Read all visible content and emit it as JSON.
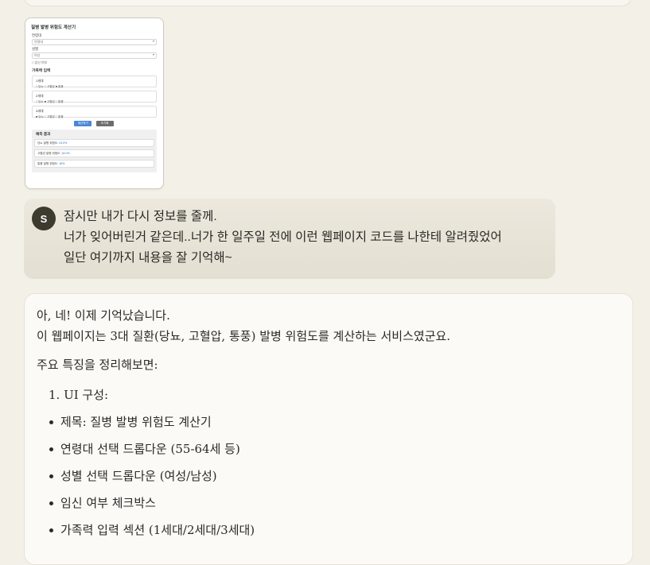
{
  "thumbnail": {
    "title": "질병 발병 위험도 계산기",
    "age_label": "연령대",
    "age_value": "연령대",
    "gender_label": "성별",
    "gender_value": "여성",
    "pregnant_label": "임신 여부",
    "family_title": "가족력 입력",
    "generations": [
      {
        "name": "1세대",
        "options": "□ 당뇨  □ 고혈압  ■ 통풍"
      },
      {
        "name": "2세대",
        "options": "□ 당뇨  ■ 고혈압  □ 통풍"
      },
      {
        "name": "3세대",
        "options": "■ 당뇨  □ 고혈압  □ 통풍"
      }
    ],
    "calc_button": "계산하기",
    "reset_button": "초기화",
    "results_title": "예측 결과",
    "results": [
      {
        "label": "당뇨 발병 위험도:",
        "value": "24.0%"
      },
      {
        "label": "고혈압 발병 위험도:",
        "value": "34.0%"
      },
      {
        "label": "통풍 발병 위험도:",
        "value": "18%"
      }
    ]
  },
  "user_message": {
    "avatar_letter": "S",
    "lines": [
      "잠시만 내가 다시 정보를 줄께.",
      "너가 잊어버린거 같은데..너가 한 일주일 전에 이런 웹페이지 코드를 나한테 알려줬었어",
      "일단 여기까지 내용을 잘 기억해~"
    ]
  },
  "assistant_message": {
    "line1": "아, 네! 이제 기억났습니다.",
    "line2": "이 웹페이지는 3대 질환(당뇨, 고혈압, 통풍) 발병 위험도를 계산하는 서비스였군요.",
    "line3": "주요 특징을 정리해보면:",
    "numbered_item": "1. UI 구성:",
    "bullets": [
      "제목: 질병 발병 위험도 계산기",
      "연령대 선택 드롭다운 (55-64세 등)",
      "성별 선택 드롭다운 (여성/남성)",
      "임신 여부 체크박스",
      "가족력 입력 섹션 (1세대/2세대/3세대)"
    ]
  }
}
